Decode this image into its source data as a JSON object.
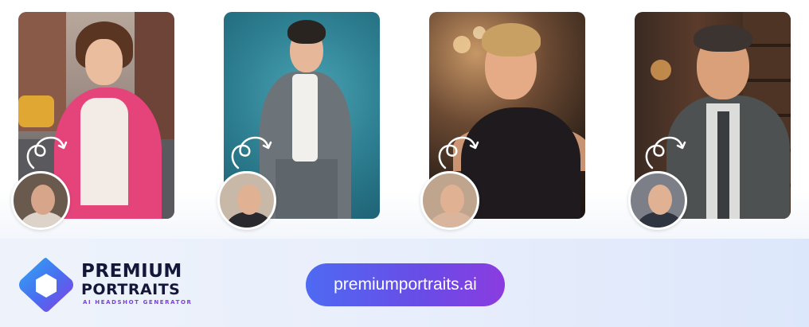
{
  "gallery": {
    "cards": [
      {
        "subject": "woman-pink-blazer-street"
      },
      {
        "subject": "man-grey-suit-teal-studio"
      },
      {
        "subject": "woman-black-dress-evening"
      },
      {
        "subject": "man-suit-library"
      }
    ]
  },
  "footer": {
    "brand_line1": "PREMIUM",
    "brand_line2": "PORTRAITS",
    "tagline": "AI HEADSHOT GENERATOR",
    "url": "premiumportraits.ai"
  },
  "colors": {
    "brand_dark": "#14163a",
    "accent_purple": "#7b3fe4",
    "pill_start": "#4e6af2",
    "pill_end": "#8b3ce0"
  }
}
